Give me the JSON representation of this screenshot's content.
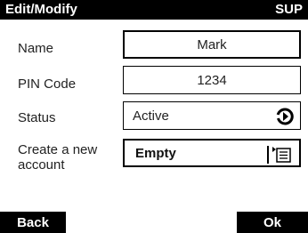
{
  "header": {
    "title": "Edit/Modify",
    "right_label": "SUP"
  },
  "form": {
    "name": {
      "label": "Name",
      "value": "Mark"
    },
    "pin": {
      "label": "PIN Code",
      "value": "1234"
    },
    "status": {
      "label": "Status",
      "value": "Active",
      "icon": "refresh-icon"
    },
    "account": {
      "label_line1": "Create a new",
      "label_line2": "account",
      "value": "Empty",
      "icon": "list-icon"
    }
  },
  "softkeys": {
    "back": "Back",
    "ok": "Ok"
  }
}
